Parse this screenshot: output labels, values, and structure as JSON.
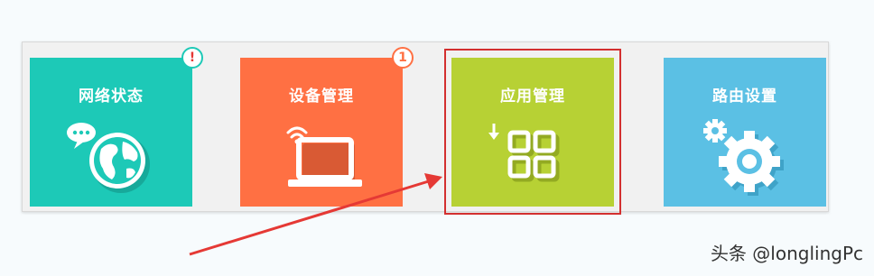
{
  "tiles": [
    {
      "title": "网络状态",
      "color": "#1dc9b7",
      "icon": "globe-chat-icon",
      "badge": "!"
    },
    {
      "title": "设备管理",
      "color": "#ff7043",
      "icon": "laptop-wifi-icon",
      "badge": "1"
    },
    {
      "title": "应用管理",
      "color": "#b7d134",
      "icon": "apps-grid-icon",
      "badge": ""
    },
    {
      "title": "路由设置",
      "color": "#5bc0e4",
      "icon": "gears-icon",
      "badge": ""
    }
  ],
  "selected_tile": "应用管理",
  "annotation": {
    "arrow_color": "#e53935",
    "highlight_color": "#d32f2f"
  },
  "watermark": "头条 @longlingPc"
}
